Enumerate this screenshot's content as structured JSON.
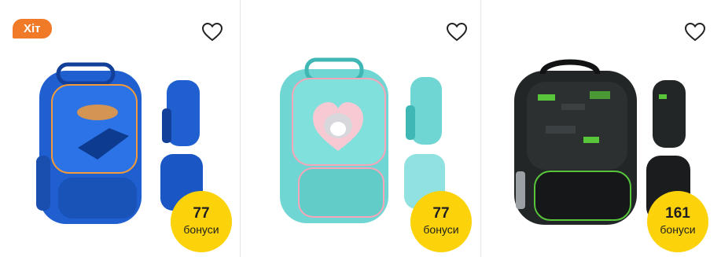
{
  "products": [
    {
      "badge": "Хіт",
      "bonus_value": "77",
      "bonus_label": "бонуси",
      "colors": {
        "main": "#1f5fcf",
        "dark": "#123f99",
        "accent": "#f29a3a"
      }
    },
    {
      "badge": "",
      "bonus_value": "77",
      "bonus_label": "бонуси",
      "colors": {
        "main": "#6fd6d3",
        "dark": "#3fb7b4",
        "accent": "#f6a6b8"
      }
    },
    {
      "badge": "",
      "bonus_value": "161",
      "bonus_label": "бонуси",
      "colors": {
        "main": "#232627",
        "dark": "#111314",
        "accent": "#58c53b"
      }
    }
  ],
  "icons": {
    "favorite": "heart-outline-icon"
  },
  "colors": {
    "badge_bg": "#f07a27",
    "bonus_bg": "#fcd30b",
    "divider": "#e6e6e6"
  }
}
